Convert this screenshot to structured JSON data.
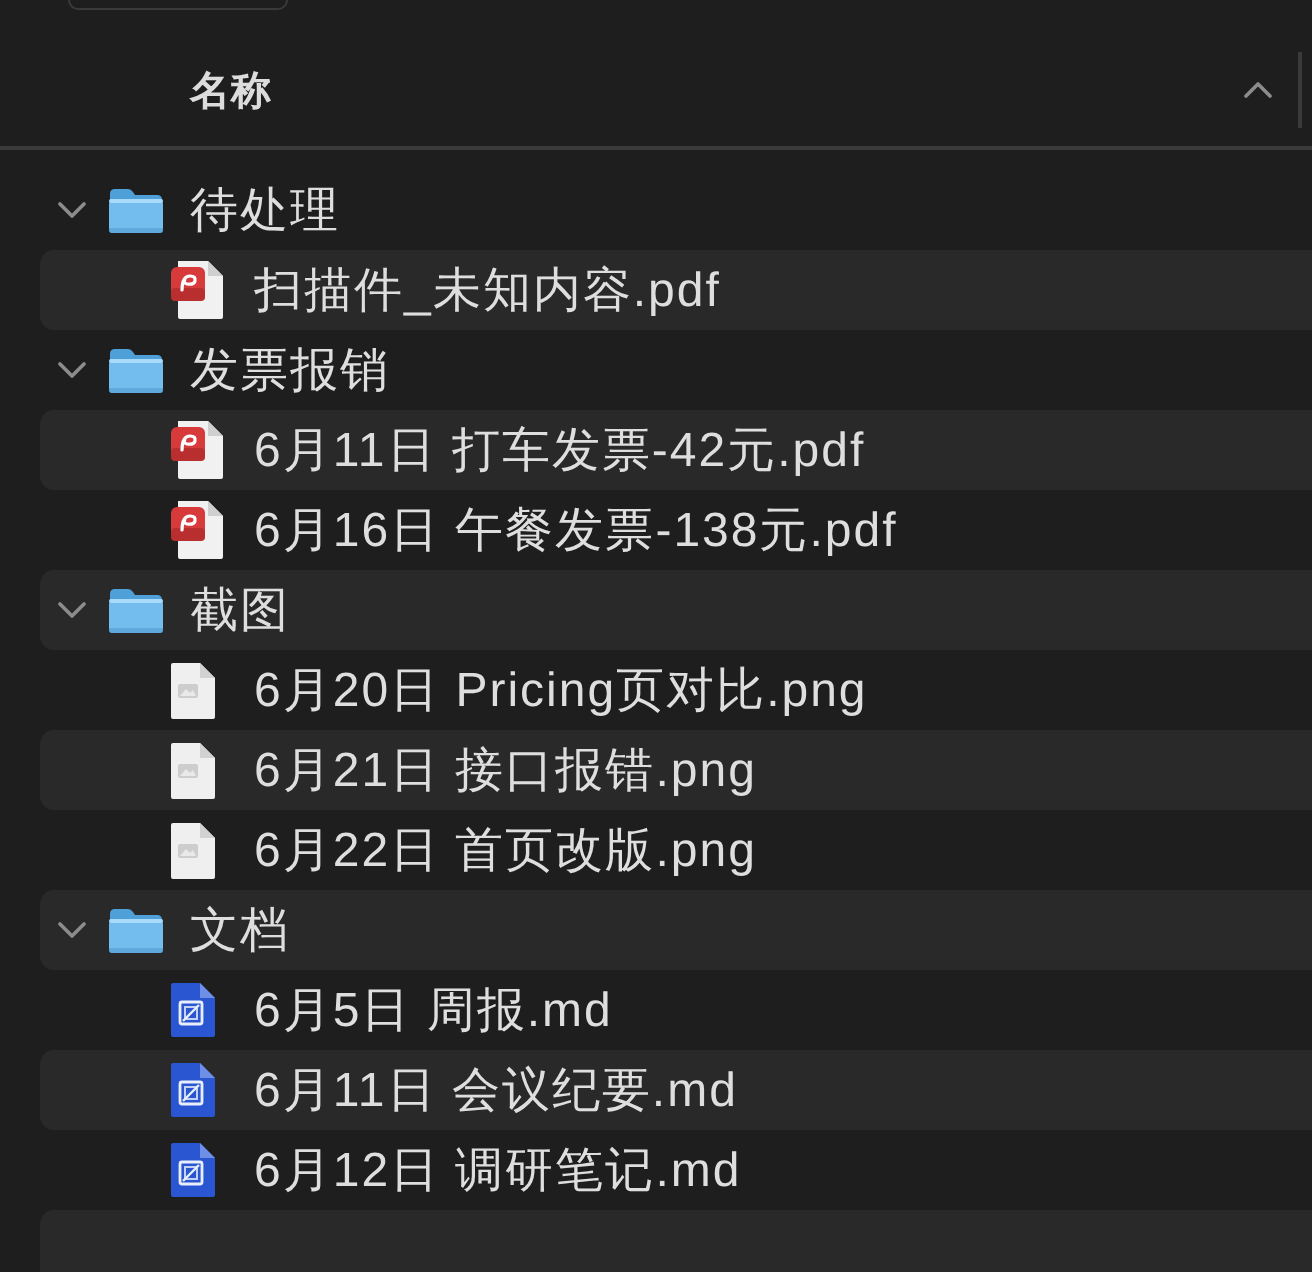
{
  "header": {
    "columns": [
      {
        "label": "名称",
        "ascending": true
      }
    ]
  },
  "items": [
    {
      "kind": "folder",
      "name": "待处理",
      "expanded": true,
      "children": [
        {
          "kind": "pdf",
          "name": "扫描件_未知内容.pdf"
        }
      ]
    },
    {
      "kind": "folder",
      "name": "发票报销",
      "expanded": true,
      "children": [
        {
          "kind": "pdf",
          "name": "6月11日 打车发票-42元.pdf"
        },
        {
          "kind": "pdf",
          "name": "6月16日 午餐发票-138元.pdf"
        }
      ]
    },
    {
      "kind": "folder",
      "name": "截图",
      "expanded": true,
      "children": [
        {
          "kind": "image",
          "name": "6月20日 Pricing页对比.png"
        },
        {
          "kind": "image",
          "name": "6月21日 接口报错.png"
        },
        {
          "kind": "image",
          "name": "6月22日 首页改版.png"
        }
      ]
    },
    {
      "kind": "folder",
      "name": "文档",
      "expanded": true,
      "children": [
        {
          "kind": "markdown",
          "name": "6月5日 周报.md"
        },
        {
          "kind": "markdown",
          "name": "6月11日 会议纪要.md"
        },
        {
          "kind": "markdown",
          "name": "6月12日 调研笔记.md"
        }
      ]
    }
  ]
}
